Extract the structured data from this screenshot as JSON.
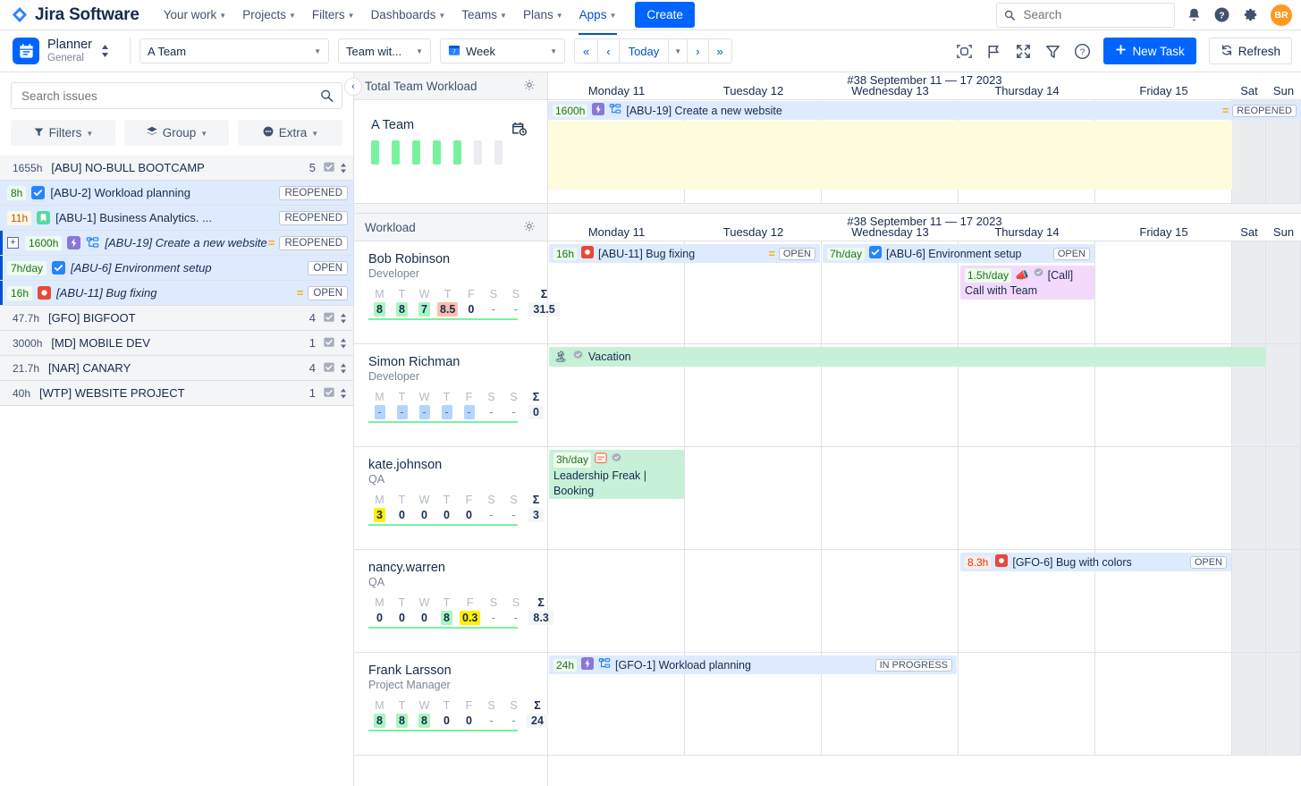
{
  "topnav": {
    "brand": "Jira Software",
    "items": [
      {
        "label": "Your work",
        "caret": true,
        "active": false
      },
      {
        "label": "Projects",
        "caret": true,
        "active": false
      },
      {
        "label": "Filters",
        "caret": true,
        "active": false
      },
      {
        "label": "Dashboards",
        "caret": true,
        "active": false
      },
      {
        "label": "Teams",
        "caret": true,
        "active": false
      },
      {
        "label": "Plans",
        "caret": true,
        "active": false
      },
      {
        "label": "Apps",
        "caret": true,
        "active": true
      }
    ],
    "create_label": "Create",
    "search_placeholder": "Search",
    "avatar_initials": "BR"
  },
  "toolbar": {
    "planner_title": "Planner",
    "planner_subtitle": "General",
    "team_select": "A Team",
    "teamwith_select": "Team wit...",
    "view_select": "Week",
    "nav_first": "«",
    "nav_prev": "‹",
    "today_label": "Today",
    "nav_next": "›",
    "nav_last": "»",
    "new_task_label": "New Task",
    "refresh_label": "Refresh"
  },
  "left": {
    "search_placeholder": "Search issues",
    "filters_label": "Filters",
    "group_label": "Group",
    "extra_label": "Extra",
    "rows": [
      {
        "kind": "project",
        "hours": "1655h",
        "hours_style": "grey",
        "text": "[ABU] NO-BULL BOOTCAMP",
        "count": "5"
      },
      {
        "kind": "child",
        "hours": "8h",
        "hours_style": "green",
        "icon": "task-check-icon",
        "text": "[ABU-2] Workload planning",
        "status": "REOPENED",
        "italic": false,
        "selected": false
      },
      {
        "kind": "child",
        "hours": "11h",
        "hours_style": "orange",
        "icon": "story-bookmark-icon",
        "text": "[ABU-1] Business Analytics. ...",
        "status": "REOPENED",
        "italic": false,
        "selected": false
      },
      {
        "kind": "child",
        "hours": "1600h",
        "hours_style": "green",
        "icon": "epic-bolt-icon",
        "icon2": "subtask-tree-icon",
        "text": "[ABU-19] Create a new website",
        "status": "REOPENED",
        "italic": true,
        "selected": true,
        "expander": "+",
        "equal": true
      },
      {
        "kind": "child",
        "hours": "7h/day",
        "hours_style": "green",
        "icon": "task-check-icon",
        "text": "[ABU-6] Environment setup",
        "status": "OPEN",
        "italic": true,
        "selected": true
      },
      {
        "kind": "child",
        "hours": "16h",
        "hours_style": "green",
        "icon": "bug-icon",
        "text": "[ABU-11] Bug fixing",
        "status": "OPEN",
        "italic": true,
        "selected": true,
        "equal": true
      },
      {
        "kind": "project",
        "hours": "47.7h",
        "hours_style": "grey",
        "text": "[GFO] BIGFOOT",
        "count": "4"
      },
      {
        "kind": "project",
        "hours": "3000h",
        "hours_style": "grey",
        "text": "[MD] MOBILE DEV",
        "count": "1"
      },
      {
        "kind": "project",
        "hours": "21.7h",
        "hours_style": "grey",
        "text": "[NAR] CANARY",
        "count": "4"
      },
      {
        "kind": "project",
        "hours": "40h",
        "hours_style": "grey",
        "text": "[WTP] WEBSITE PROJECT",
        "count": "1"
      }
    ]
  },
  "timeline": {
    "total_panel_title": "Total Team Workload",
    "workload_panel_title": "Workload",
    "week_title": "#38 September 11 — 17 2023",
    "days": [
      "Monday 11",
      "Tuesday 12",
      "Wednesday 13",
      "Thursday 14",
      "Friday 15",
      "Sat",
      "Sun"
    ],
    "team": {
      "name": "A Team",
      "bars": [
        "full",
        "full",
        "full",
        "full",
        "full",
        "empty",
        "empty"
      ]
    },
    "team_bar": {
      "hours": "1600h",
      "icon": "epic-bolt-icon",
      "icon2": "subtask-tree-icon",
      "text": "[ABU-19] Create a new website",
      "status": "REOPENED",
      "equal": true
    },
    "day_headers": [
      "M",
      "T",
      "W",
      "T",
      "F",
      "S",
      "S",
      "Σ"
    ],
    "resources": [
      {
        "name": "Bob Robinson",
        "role": "Developer",
        "values": [
          "8",
          "8",
          "7",
          "8.5",
          "0",
          "-",
          "-"
        ],
        "styles": [
          "g",
          "g",
          "g",
          "r",
          "n",
          "dash",
          "dash"
        ],
        "total": "31.5",
        "tasks": [
          {
            "row": 0,
            "start": 0,
            "span": 2,
            "color": "blue",
            "hours": "16h",
            "hours_color": "green",
            "icon": "bug-icon",
            "text": "[ABU-11] Bug fixing",
            "status": "OPEN",
            "equal": true
          },
          {
            "row": 0,
            "start": 2,
            "span": 2,
            "color": "blue",
            "hours": "7h/day",
            "hours_color": "green",
            "icon": "task-check-icon",
            "text": "[ABU-6] Environment setup",
            "status": "OPEN",
            "equal": false
          },
          {
            "row": 1,
            "start": 3,
            "span": 1,
            "color": "purple",
            "tall": true,
            "hours": "1.5h/day",
            "hours_color": "green",
            "icon": "call-megaphone-icon",
            "icon2": "verified-grey-icon",
            "text": "[Call]",
            "text2": "Call with Team"
          }
        ]
      },
      {
        "name": "Simon Richman",
        "role": "Developer",
        "values": [
          "-",
          "-",
          "-",
          "-",
          "-",
          "-",
          "-"
        ],
        "styles": [
          "b",
          "b",
          "b",
          "b",
          "b",
          "dash",
          "dash"
        ],
        "total": "0",
        "tasks": [
          {
            "row": 0,
            "start": 0,
            "span": 5,
            "color": "green",
            "icon": "vacation-palm-icon",
            "icon2": "verified-grey-icon",
            "text": "Vacation"
          }
        ]
      },
      {
        "name": "kate.johnson",
        "role": "QA",
        "values": [
          "3",
          "0",
          "0",
          "0",
          "0",
          "-",
          "-"
        ],
        "styles": [
          "y",
          "n",
          "n",
          "n",
          "n",
          "dash",
          "dash"
        ],
        "total": "3",
        "tasks": [
          {
            "row": 0,
            "start": 0,
            "span": 1,
            "color": "green",
            "tall2": true,
            "hours": "3h/day",
            "hours_color": "green",
            "icon": "booking-red-icon",
            "icon2": "verified-grey-icon",
            "text2": "Leadership Freak | Booking"
          }
        ]
      },
      {
        "name": "nancy.warren",
        "role": "QA",
        "values": [
          "0",
          "0",
          "0",
          "8",
          "0.3",
          "-",
          "-"
        ],
        "styles": [
          "n",
          "n",
          "n",
          "g",
          "y",
          "dash",
          "dash"
        ],
        "total": "8.3",
        "tasks": [
          {
            "row": 0,
            "start": 3,
            "span": 2,
            "color": "blue",
            "hours": "8.3h",
            "hours_color": "red",
            "icon": "bug-icon",
            "text": "[GFO-6] Bug with colors",
            "status": "OPEN"
          }
        ]
      },
      {
        "name": "Frank Larsson",
        "role": "Project Manager",
        "values": [
          "8",
          "8",
          "8",
          "0",
          "0",
          "-",
          "-"
        ],
        "styles": [
          "g",
          "g",
          "g",
          "n",
          "n",
          "dash",
          "dash"
        ],
        "total": "24",
        "tasks": [
          {
            "row": 0,
            "start": 0,
            "span": 3,
            "color": "blue",
            "hours": "24h",
            "hours_color": "green",
            "icon": "epic-bolt-icon",
            "icon2": "subtask-tree-icon",
            "text": "[GFO-1] Workload planning",
            "status": "IN PROGRESS"
          }
        ]
      }
    ]
  },
  "colors": {
    "brand_blue": "#0052cc",
    "primary_button": "#0065ff",
    "avatar": "#ff991f",
    "green_bar": "#79f2a0",
    "epic_purple": "#8777d9",
    "bug_red": "#e5493a"
  }
}
